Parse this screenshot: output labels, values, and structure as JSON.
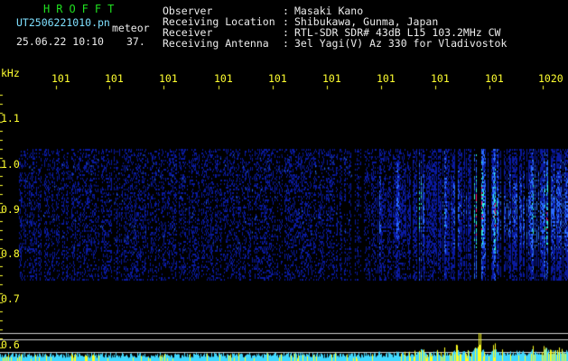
{
  "header": {
    "brand": "HROFFT",
    "file_name": "UT2506221010.pn",
    "mode": "meteor",
    "date_time": "25.06.22 10:10",
    "count": "37.",
    "info": [
      {
        "label": "Observer",
        "value": "Masaki Kano"
      },
      {
        "label": "Receiving Location",
        "value": "Shibukawa, Gunma, Japan"
      },
      {
        "label": "Receiver",
        "value": "RTL-SDR SDR# 43dB L15 103.2MHz CW"
      },
      {
        "label": "Receiving Antenna",
        "value": "3el Yagi(V) Az 330 for Vladivostok"
      }
    ]
  },
  "axes": {
    "unit": "kHz",
    "x_ticks": [
      "101",
      "101",
      "101",
      "101",
      "101",
      "101",
      "101",
      "101",
      "101",
      "1020"
    ],
    "y_ticks": [
      "1.1",
      "1.0",
      "0.9",
      "0.8",
      "0.7",
      "0.6"
    ]
  },
  "colors": {
    "background": "#000000",
    "brand": "#20e020",
    "file_info": "#7fe0ff",
    "axis_labels": "#ffff30",
    "grid": "#ffff30",
    "noise_low": "#0a1aa0",
    "noise_mid": "#2a6cff",
    "signal_high": "#30ffe0",
    "signal_peak": "#ff2080",
    "level_trace_cyan": "#40d8ff",
    "level_trace_yellow": "#ffff20",
    "threshold_line": "#d0d0d0"
  }
}
